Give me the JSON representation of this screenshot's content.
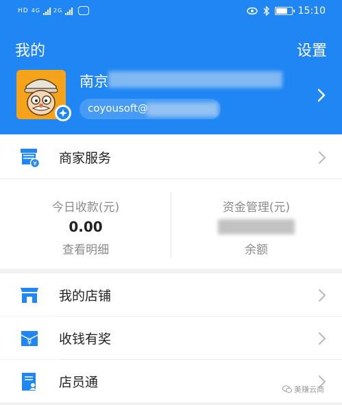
{
  "status_bar": {
    "network_left": "HD",
    "sig1": "4G",
    "sig2": "2G",
    "time": "15:10",
    "battery_level": 0.75
  },
  "header": {
    "title": "我的",
    "settings": "设置",
    "company": "南京",
    "email": "coyousoft@"
  },
  "merchant_service": {
    "label": "商家服务"
  },
  "stats": {
    "left": {
      "label": "今日收款(元)",
      "value": "0.00",
      "sub": "查看明细"
    },
    "right": {
      "label": "资金管理(元)",
      "sub": "余额"
    }
  },
  "menu": [
    {
      "label": "我的店铺",
      "icon": "store-icon"
    },
    {
      "label": "收钱有奖",
      "icon": "yen-gift-icon"
    },
    {
      "label": "店员通",
      "icon": "staff-card-icon"
    }
  ],
  "watermark": "美赚云商",
  "colors": {
    "brand_blue": "#1f86f3",
    "avatar_orange": "#f6a31c"
  }
}
